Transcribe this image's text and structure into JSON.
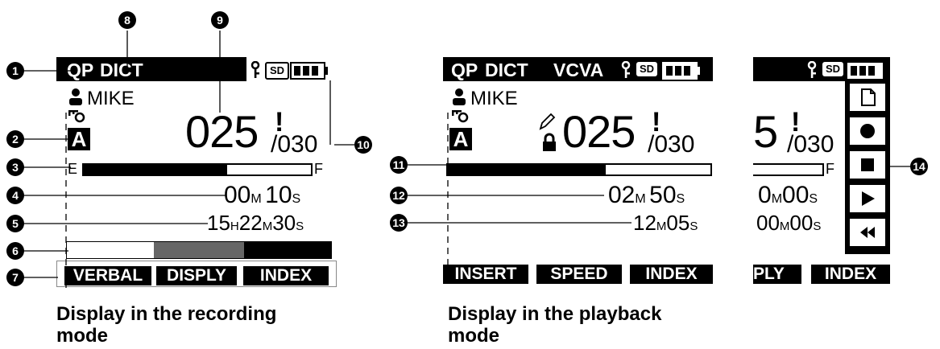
{
  "callouts": [
    "1",
    "2",
    "3",
    "4",
    "5",
    "6",
    "7",
    "8",
    "9",
    "10",
    "11",
    "12",
    "13",
    "14"
  ],
  "recording": {
    "mode": "QP",
    "type": "DICT",
    "sd": "SD",
    "author": "MIKE",
    "worktype": "A",
    "file_number": "025",
    "file_total": "/030",
    "empty_label": "E",
    "full_label": "F",
    "elapsed_min": "00",
    "elapsed_sec": "10",
    "remain_h": "15",
    "remain_m": "22",
    "remain_s": "30",
    "unit_m": "M",
    "unit_s": "S",
    "unit_h": "H",
    "softkeys": [
      "VERBAL",
      "DISPLY",
      "INDEX"
    ],
    "caption": [
      "Display in the recording",
      "mode"
    ]
  },
  "playback": {
    "mode": "QP",
    "type": "DICT",
    "vcva": "VCVA",
    "sd": "SD",
    "author": "MIKE",
    "worktype": "A",
    "file_number": "025",
    "file_total": "/030",
    "progress": 0.6,
    "elapsed_min": "02",
    "elapsed_sec": "50",
    "length_min": "12",
    "length_sec": "05",
    "softkeys": [
      "INSERT",
      "SPEED",
      "INDEX"
    ],
    "caption": [
      "Display in the playback",
      "mode"
    ]
  },
  "third": {
    "sd": "SD",
    "file_number_partial": "5",
    "file_total": "/030",
    "full_label": "F",
    "elapsed_partial": "0",
    "elapsed_sec": "00",
    "remain_partial": "00",
    "remain_sec": "00",
    "softkeys": [
      "PLY",
      "INDEX"
    ],
    "icons": [
      "new-file-icon",
      "record-icon",
      "stop-icon",
      "play-icon",
      "rewind-icon"
    ]
  }
}
